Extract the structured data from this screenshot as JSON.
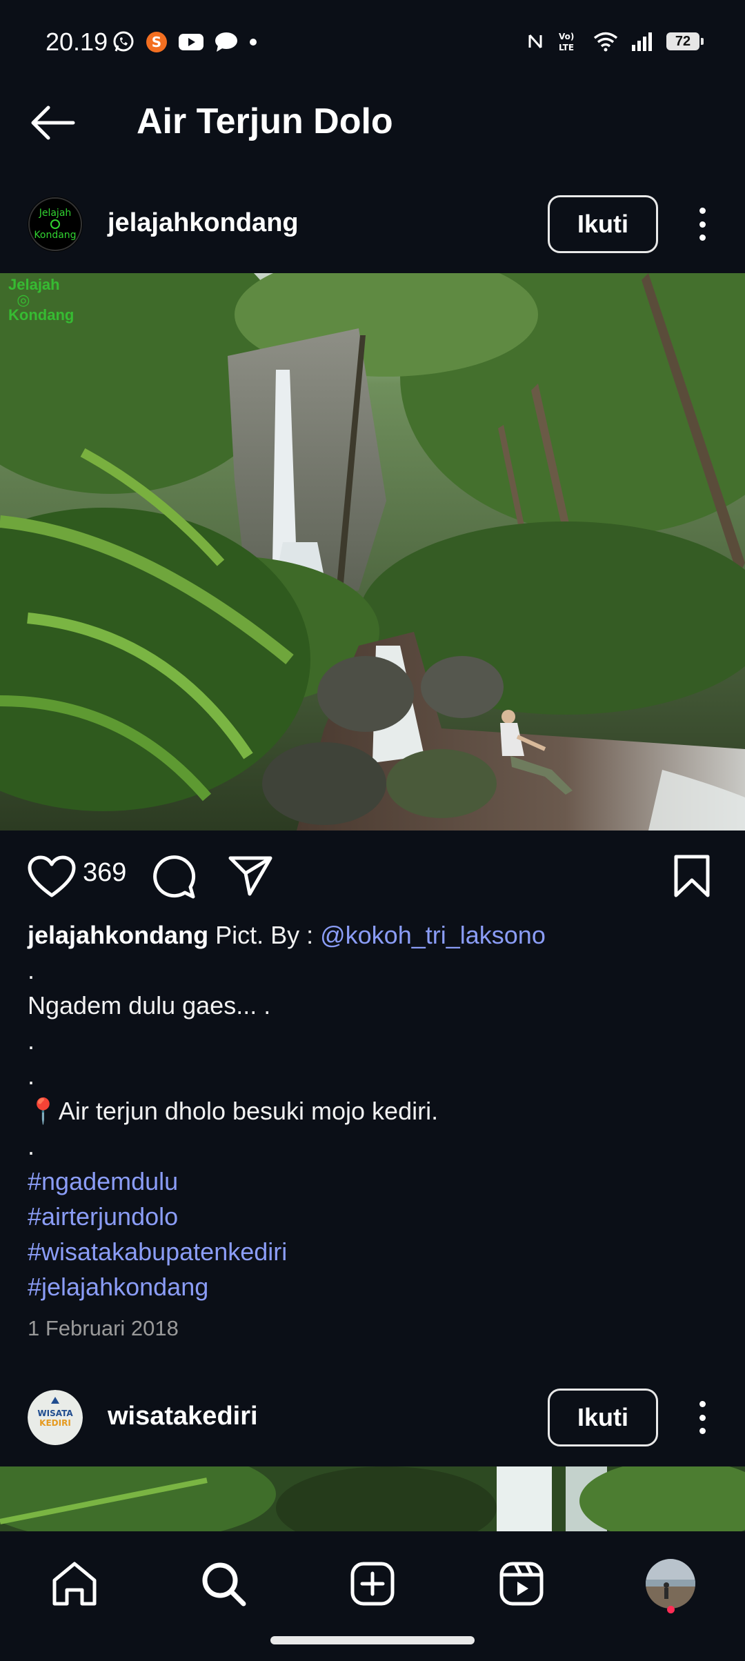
{
  "status": {
    "time": "20.19",
    "battery": "72",
    "left_icons": [
      "whatsapp-icon",
      "shopee-icon",
      "youtube-icon",
      "chat-icon",
      "dot-icon"
    ],
    "right_icons": [
      "nfc-icon",
      "volte-icon",
      "wifi-icon",
      "signal-icon",
      "battery-icon"
    ]
  },
  "header": {
    "title": "Air Terjun Dolo"
  },
  "post1": {
    "username": "jelajahkondang",
    "follow_label": "Ikuti",
    "avatar_text": "Jelajah\nKondang",
    "watermark": "Jelajah\nKondang",
    "likes": "369",
    "caption": {
      "username": "jelajahkondang",
      "lead": " Pict. By : ",
      "mention": "@kokoh_tri_laksono",
      "lines": [
        ".",
        "Ngadem dulu gaes... .",
        ".",
        ".",
        "📍Air terjun dholo besuki mojo kediri.",
        "."
      ],
      "hashtags": [
        "#ngademdulu",
        "#airterjundolo",
        "#wisatakabupatenkediri",
        "#jelajahkondang"
      ]
    },
    "date": "1 Februari 2018"
  },
  "post2": {
    "username": "wisatakediri",
    "follow_label": "Ikuti",
    "avatar_text": "WISATA\nKEDIRI"
  },
  "nav": {
    "items": [
      "home-icon",
      "search-icon",
      "create-icon",
      "reels-icon",
      "profile-avatar"
    ]
  },
  "colors": {
    "background": "#0b0f17",
    "link": "#8b9df7",
    "notification": "#ff2d55"
  }
}
